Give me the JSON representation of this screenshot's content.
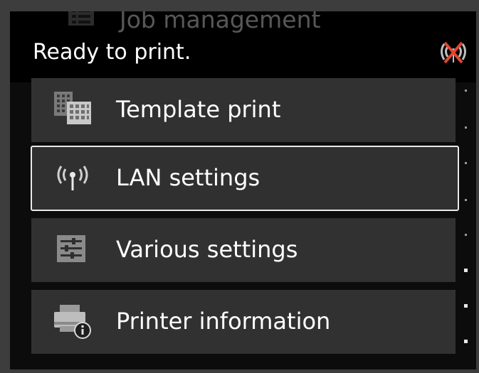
{
  "status_bar": {
    "message": "Ready to print.",
    "network_icon": "network-disconnected-icon",
    "ghost_item": {
      "label": "Job management",
      "icon": "job-management-icon"
    }
  },
  "menu": {
    "items": [
      {
        "label": "Template print",
        "icon": "template-print-icon",
        "selected": false
      },
      {
        "label": "LAN settings",
        "icon": "wireless-antenna-icon",
        "selected": true
      },
      {
        "label": "Various settings",
        "icon": "settings-sliders-icon",
        "selected": false
      },
      {
        "label": "Printer information",
        "icon": "printer-info-icon",
        "selected": false
      }
    ]
  },
  "colors": {
    "background": "#0c0c0c",
    "item_background": "#313131",
    "selected_border": "#eaeaea",
    "text": "#ffffff",
    "disconnected_x": "#e4452f"
  }
}
